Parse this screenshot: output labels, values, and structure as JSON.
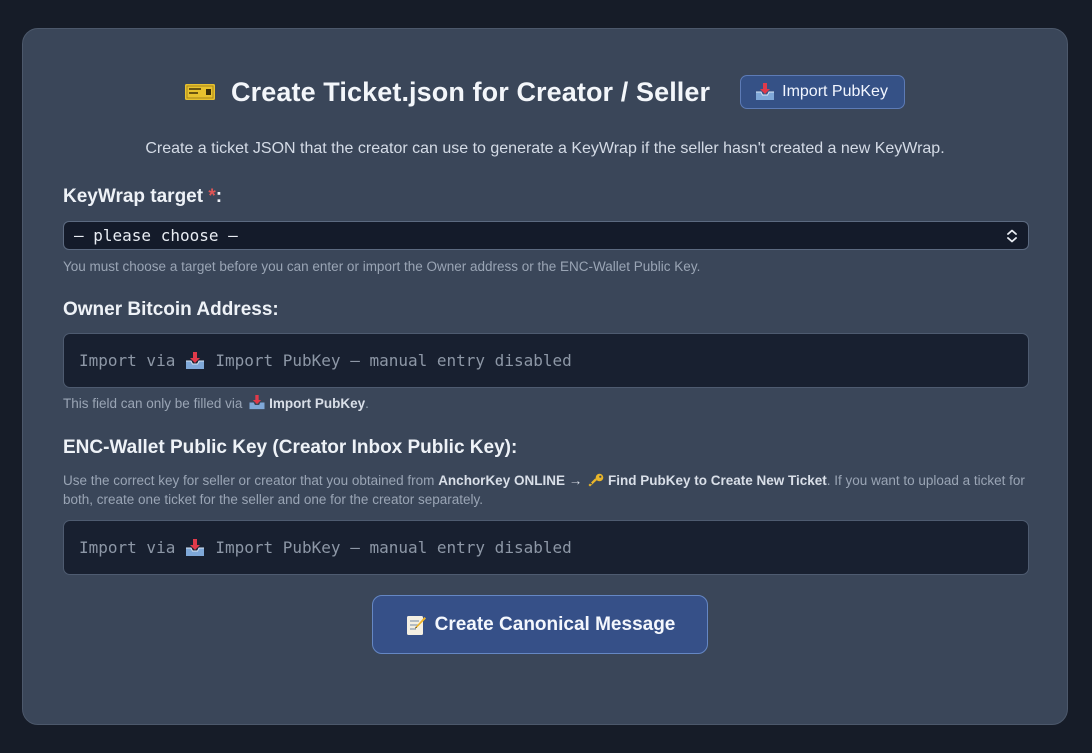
{
  "header": {
    "title": "Create Ticket.json for Creator / Seller",
    "import_button": "Import PubKey",
    "subtitle": "Create a ticket JSON that the creator can use to generate a KeyWrap if the seller hasn't created a new KeyWrap."
  },
  "keywrap_target": {
    "label": "KeyWrap target",
    "required_mark": "*",
    "colon": ":",
    "selected": "— please choose —",
    "hint": "You must choose a target before you can enter or import the Owner address or the ENC-Wallet Public Key."
  },
  "owner_address": {
    "label": "Owner Bitcoin Address:",
    "placeholder_prefix": "Import via",
    "placeholder_suffix": "Import PubKey — manual entry disabled",
    "hint_prefix": "This field can only be filled via",
    "hint_bold": "Import PubKey",
    "hint_suffix": "."
  },
  "enc_wallet": {
    "label": "ENC-Wallet Public Key (Creator Inbox Public Key):",
    "hint_part1": "Use the correct key for seller or creator that you obtained from",
    "hint_bold1": "AnchorKey ONLINE →",
    "hint_bold2": "Find PubKey to Create New Ticket",
    "hint_part2": ". If you want to upload a ticket for both, create one ticket for the seller and one for the creator separately.",
    "placeholder_prefix": "Import via",
    "placeholder_suffix": "Import PubKey — manual entry disabled"
  },
  "actions": {
    "create_button": "Create Canonical Message"
  },
  "icons": {
    "title": "ticket-icon",
    "import": "inbox-tray-icon",
    "select": "chevron-updown-icon",
    "key": "key-icon",
    "cta": "memo-icon"
  },
  "colors": {
    "card_bg": "#3a4659",
    "page_bg": "#161c28",
    "button_bg": "#355186",
    "required": "#e05555"
  }
}
